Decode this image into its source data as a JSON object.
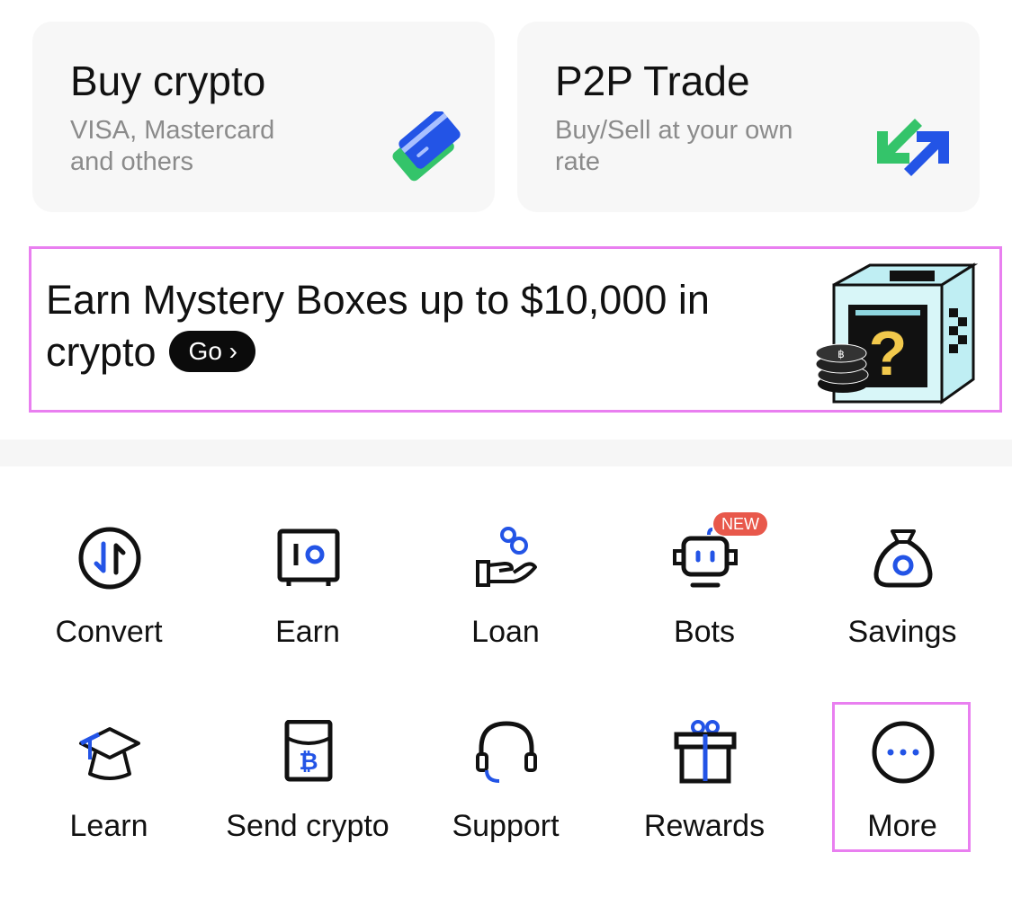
{
  "cards": {
    "buy": {
      "title": "Buy crypto",
      "subtitle": "VISA, Mastercard and others",
      "icon": "card-icon"
    },
    "p2p": {
      "title": "P2P Trade",
      "subtitle": "Buy/Sell at your own rate",
      "icon": "swap-arrows-icon"
    }
  },
  "promo": {
    "text": "Earn Mystery Boxes up to $10,000 in crypto",
    "button": "Go ›"
  },
  "shortcuts": [
    {
      "label": "Convert",
      "icon": "convert-icon"
    },
    {
      "label": "Earn",
      "icon": "safe-icon"
    },
    {
      "label": "Loan",
      "icon": "loan-hand-coins-icon"
    },
    {
      "label": "Bots",
      "icon": "robot-icon",
      "badge": "NEW"
    },
    {
      "label": "Savings",
      "icon": "money-bag-icon"
    },
    {
      "label": "Learn",
      "icon": "graduation-cap-icon"
    },
    {
      "label": "Send crypto",
      "icon": "red-packet-icon"
    },
    {
      "label": "Support",
      "icon": "headset-icon"
    },
    {
      "label": "Rewards",
      "icon": "gift-icon"
    },
    {
      "label": "More",
      "icon": "more-dots-icon"
    }
  ],
  "colors": {
    "accent_blue": "#2354e6",
    "accent_green": "#34c46a",
    "badge_red": "#e8584b",
    "highlight": "#e97ff0"
  }
}
